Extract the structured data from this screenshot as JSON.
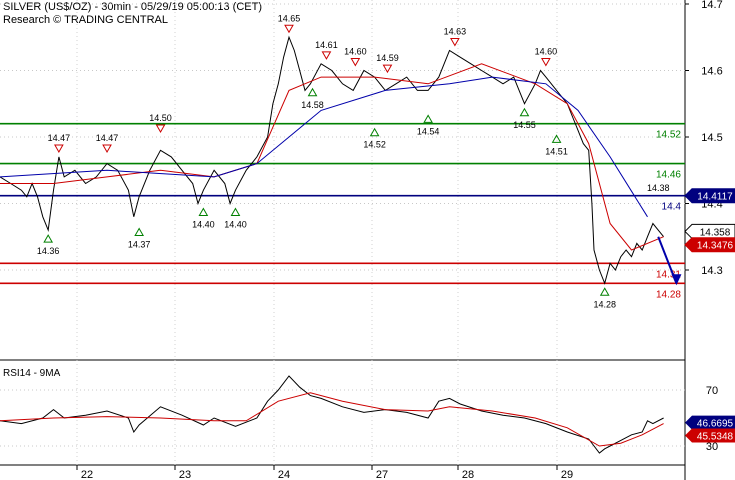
{
  "header": {
    "title": "SILVER (US$/OZ) - 30min - 05/29/19 05:00:13 (CET)",
    "subtitle": "Research © TRADING CENTRAL"
  },
  "chart_data": [
    {
      "type": "line",
      "title": "SILVER (US$/OZ) - 30min - 05/29/19 05:00:13 (CET)",
      "xlabel": "",
      "ylabel": "",
      "ylim": [
        14.2,
        14.7
      ],
      "y_ticks": [
        "14.7",
        "14.6",
        "14.5",
        "14.4",
        "14.3"
      ],
      "x_ticks": [
        "22",
        "23",
        "24",
        "27",
        "28",
        "29"
      ],
      "x_domain": [
        0,
        6.4
      ],
      "x_tick_positions": [
        1,
        2,
        3,
        4,
        5,
        6
      ],
      "grid": "dotted horizontal",
      "series": [
        {
          "name": "",
          "color": "#000000",
          "points": [
            [
              0,
              14.44
            ],
            [
              0.1,
              14.43
            ],
            [
              0.2,
              14.42
            ],
            [
              0.25,
              14.41
            ],
            [
              0.3,
              14.43
            ],
            [
              0.35,
              14.41
            ],
            [
              0.4,
              14.38
            ],
            [
              0.45,
              14.36
            ],
            [
              0.5,
              14.42
            ],
            [
              0.55,
              14.47
            ],
            [
              0.6,
              14.44
            ],
            [
              0.7,
              14.45
            ],
            [
              0.8,
              14.43
            ],
            [
              0.9,
              14.44
            ],
            [
              1.0,
              14.46
            ],
            [
              1.1,
              14.45
            ],
            [
              1.2,
              14.42
            ],
            [
              1.25,
              14.38
            ],
            [
              1.3,
              14.41
            ],
            [
              1.4,
              14.45
            ],
            [
              1.5,
              14.48
            ],
            [
              1.6,
              14.47
            ],
            [
              1.7,
              14.45
            ],
            [
              1.8,
              14.43
            ],
            [
              1.85,
              14.4
            ],
            [
              1.9,
              14.42
            ],
            [
              2.0,
              14.45
            ],
            [
              2.1,
              14.43
            ],
            [
              2.15,
              14.4
            ],
            [
              2.2,
              14.42
            ],
            [
              2.3,
              14.45
            ],
            [
              2.4,
              14.47
            ],
            [
              2.5,
              14.5
            ],
            [
              2.55,
              14.55
            ],
            [
              2.6,
              14.58
            ],
            [
              2.65,
              14.62
            ],
            [
              2.7,
              14.65
            ],
            [
              2.75,
              14.63
            ],
            [
              2.8,
              14.6
            ],
            [
              2.85,
              14.57
            ],
            [
              2.9,
              14.58
            ],
            [
              3.0,
              14.61
            ],
            [
              3.1,
              14.6
            ],
            [
              3.2,
              14.58
            ],
            [
              3.3,
              14.57
            ],
            [
              3.4,
              14.6
            ],
            [
              3.5,
              14.59
            ],
            [
              3.6,
              14.57
            ],
            [
              3.7,
              14.58
            ],
            [
              3.8,
              14.59
            ],
            [
              3.9,
              14.57
            ],
            [
              4.0,
              14.57
            ],
            [
              4.1,
              14.59
            ],
            [
              4.2,
              14.63
            ],
            [
              4.3,
              14.62
            ],
            [
              4.4,
              14.61
            ],
            [
              4.5,
              14.6
            ],
            [
              4.6,
              14.59
            ],
            [
              4.7,
              14.58
            ],
            [
              4.8,
              14.59
            ],
            [
              4.9,
              14.55
            ],
            [
              5.0,
              14.58
            ],
            [
              5.05,
              14.6
            ],
            [
              5.1,
              14.59
            ],
            [
              5.2,
              14.57
            ],
            [
              5.3,
              14.55
            ],
            [
              5.35,
              14.53
            ],
            [
              5.4,
              14.51
            ],
            [
              5.45,
              14.49
            ],
            [
              5.5,
              14.48
            ],
            [
              5.53,
              14.4
            ],
            [
              5.55,
              14.33
            ],
            [
              5.6,
              14.3
            ],
            [
              5.65,
              14.28
            ],
            [
              5.7,
              14.31
            ],
            [
              5.75,
              14.3
            ],
            [
              5.8,
              14.32
            ],
            [
              5.85,
              14.33
            ],
            [
              5.9,
              14.32
            ],
            [
              5.95,
              14.34
            ],
            [
              6.0,
              14.33
            ],
            [
              6.05,
              14.35
            ],
            [
              6.1,
              14.37
            ],
            [
              6.15,
              14.36
            ],
            [
              6.2,
              14.35
            ]
          ]
        },
        {
          "name": "",
          "color": "#cc0000",
          "points": [
            [
              0,
              14.43
            ],
            [
              0.5,
              14.43
            ],
            [
              1.0,
              14.44
            ],
            [
              1.5,
              14.45
            ],
            [
              2.0,
              14.44
            ],
            [
              2.4,
              14.46
            ],
            [
              2.7,
              14.57
            ],
            [
              3.0,
              14.59
            ],
            [
              3.5,
              14.59
            ],
            [
              4.0,
              14.58
            ],
            [
              4.5,
              14.61
            ],
            [
              5.0,
              14.58
            ],
            [
              5.3,
              14.55
            ],
            [
              5.5,
              14.49
            ],
            [
              5.7,
              14.37
            ],
            [
              5.9,
              14.33
            ],
            [
              6.2,
              14.35
            ]
          ]
        },
        {
          "name": "",
          "color": "#0000aa",
          "points": [
            [
              0,
              14.44
            ],
            [
              1.0,
              14.45
            ],
            [
              2.0,
              14.44
            ],
            [
              2.4,
              14.46
            ],
            [
              3.0,
              14.54
            ],
            [
              3.6,
              14.57
            ],
            [
              4.2,
              14.58
            ],
            [
              4.6,
              14.59
            ],
            [
              5.1,
              14.58
            ],
            [
              5.4,
              14.54
            ],
            [
              5.7,
              14.47
            ],
            [
              6.05,
              14.38
            ]
          ]
        },
        {
          "name": "",
          "color": "#0000aa",
          "points": [
            [
              6.15,
              14.35
            ],
            [
              6.32,
              14.28
            ]
          ],
          "arrow": true
        }
      ],
      "horizontal_lines": [
        {
          "value": 14.52,
          "label": "14.52",
          "color": "#008000"
        },
        {
          "value": 14.46,
          "label": "14.46",
          "color": "#008000"
        },
        {
          "value": 14.4117,
          "label": "14.4",
          "color": "#00007f"
        },
        {
          "value": 14.31,
          "label": "14.31",
          "color": "#cc0000"
        },
        {
          "value": 14.28,
          "label": "14.28",
          "color": "#cc0000"
        }
      ],
      "peak_markers": [
        {
          "x": 0.55,
          "y": 14.47,
          "label": "14.47"
        },
        {
          "x": 1.0,
          "y": 14.47,
          "label": "14.47"
        },
        {
          "x": 1.5,
          "y": 14.5,
          "label": "14.50"
        },
        {
          "x": 2.7,
          "y": 14.65,
          "label": "14.65"
        },
        {
          "x": 3.05,
          "y": 14.61,
          "label": "14.61"
        },
        {
          "x": 3.32,
          "y": 14.6,
          "label": "14.60"
        },
        {
          "x": 3.62,
          "y": 14.59,
          "label": "14.59"
        },
        {
          "x": 4.25,
          "y": 14.63,
          "label": "14.63"
        },
        {
          "x": 5.1,
          "y": 14.6,
          "label": "14.60"
        }
      ],
      "trough_markers": [
        {
          "x": 0.45,
          "y": 14.36,
          "label": "14.36"
        },
        {
          "x": 1.3,
          "y": 14.37,
          "label": "14.37"
        },
        {
          "x": 1.9,
          "y": 14.4,
          "label": "14.40"
        },
        {
          "x": 2.2,
          "y": 14.4,
          "label": "14.40"
        },
        {
          "x": 2.92,
          "y": 14.58,
          "label": "14.58"
        },
        {
          "x": 3.5,
          "y": 14.52,
          "label": "14.52"
        },
        {
          "x": 4.0,
          "y": 14.54,
          "label": "14.54"
        },
        {
          "x": 4.9,
          "y": 14.55,
          "label": "14.55"
        },
        {
          "x": 5.2,
          "y": 14.51,
          "label": "14.51"
        },
        {
          "x": 5.65,
          "y": 14.28,
          "label": "14.28"
        }
      ],
      "annotations": [
        {
          "x": 6.3,
          "y": 14.41,
          "label": "14.38"
        }
      ],
      "price_tags": [
        {
          "value": 14.4117,
          "label": "14.4117",
          "bg": "#00007f",
          "fg": "#ffffff"
        },
        {
          "value": 14.358,
          "label": "14.358",
          "bg": "#ffffff",
          "fg": "#000000"
        },
        {
          "value": 14.338,
          "label": "14.3476",
          "bg": "#cc0000",
          "fg": "#ffffff"
        }
      ]
    },
    {
      "type": "line",
      "title": "RSI14 - 9MA",
      "xlabel": "",
      "ylabel": "",
      "ylim": [
        22,
        82
      ],
      "y_ticks": [
        "70",
        "30"
      ],
      "series": [
        {
          "name": "",
          "color": "#000000",
          "points": [
            [
              0,
              48
            ],
            [
              0.2,
              46
            ],
            [
              0.4,
              50
            ],
            [
              0.5,
              56
            ],
            [
              0.6,
              50
            ],
            [
              0.8,
              52
            ],
            [
              1.0,
              55
            ],
            [
              1.2,
              50
            ],
            [
              1.25,
              40
            ],
            [
              1.3,
              45
            ],
            [
              1.5,
              58
            ],
            [
              1.7,
              52
            ],
            [
              1.9,
              45
            ],
            [
              2.0,
              50
            ],
            [
              2.2,
              44
            ],
            [
              2.4,
              50
            ],
            [
              2.5,
              62
            ],
            [
              2.6,
              70
            ],
            [
              2.7,
              80
            ],
            [
              2.8,
              72
            ],
            [
              2.9,
              66
            ],
            [
              3.0,
              64
            ],
            [
              3.2,
              58
            ],
            [
              3.4,
              54
            ],
            [
              3.6,
              56
            ],
            [
              3.8,
              54
            ],
            [
              4.0,
              50
            ],
            [
              4.1,
              62
            ],
            [
              4.2,
              64
            ],
            [
              4.3,
              60
            ],
            [
              4.5,
              55
            ],
            [
              4.7,
              52
            ],
            [
              4.9,
              50
            ],
            [
              5.1,
              46
            ],
            [
              5.3,
              40
            ],
            [
              5.5,
              35
            ],
            [
              5.6,
              25
            ],
            [
              5.65,
              28
            ],
            [
              5.7,
              30
            ],
            [
              5.8,
              34
            ],
            [
              5.9,
              38
            ],
            [
              6.0,
              40
            ],
            [
              6.05,
              48
            ],
            [
              6.1,
              46
            ],
            [
              6.2,
              50
            ]
          ]
        },
        {
          "name": "",
          "color": "#cc0000",
          "points": [
            [
              0,
              48
            ],
            [
              0.5,
              50
            ],
            [
              1.0,
              51
            ],
            [
              1.5,
              50
            ],
            [
              2.0,
              48
            ],
            [
              2.3,
              48
            ],
            [
              2.6,
              62
            ],
            [
              2.9,
              68
            ],
            [
              3.2,
              62
            ],
            [
              3.6,
              56
            ],
            [
              4.0,
              55
            ],
            [
              4.2,
              58
            ],
            [
              4.6,
              55
            ],
            [
              5.0,
              50
            ],
            [
              5.3,
              43
            ],
            [
              5.6,
              30
            ],
            [
              5.8,
              32
            ],
            [
              6.0,
              38
            ],
            [
              6.2,
              46
            ]
          ]
        }
      ],
      "price_tags": [
        {
          "value": 46.6695,
          "label": "46.6695",
          "bg": "#00007f",
          "fg": "#ffffff"
        },
        {
          "value": 37.5,
          "label": "45.5348",
          "bg": "#cc0000",
          "fg": "#ffffff"
        }
      ]
    }
  ]
}
